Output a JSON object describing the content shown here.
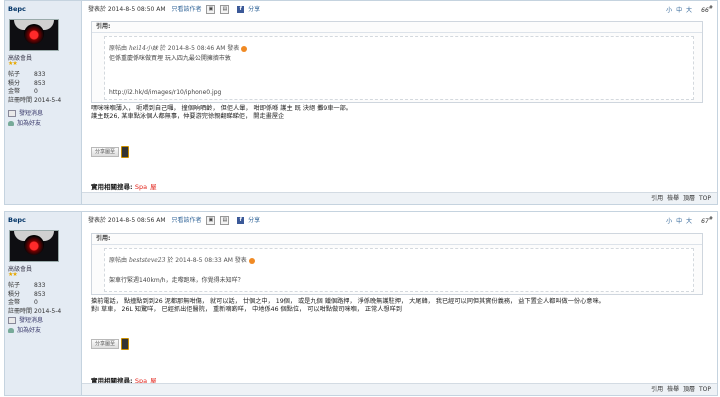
{
  "posts": [
    {
      "user": {
        "name": "Bepc",
        "rank": "高級會員",
        "stars": "★★",
        "stats": [
          {
            "k": "帖子",
            "v": "833"
          },
          {
            "k": "積分",
            "v": "853"
          },
          {
            "k": "金幣",
            "v": "0"
          },
          {
            "k": "註冊時間",
            "v": "2014-5-4"
          }
        ],
        "links": [
          "發短消息",
          "加為好友"
        ]
      },
      "posted": "發表於 2014-8-5 08:50 AM",
      "only_author": "只看該作者",
      "share": "分享",
      "font_size": "小 中 大",
      "floor": "66",
      "quote": {
        "label": "引用:",
        "meta_user": "原帖由",
        "meta_user_name": "hei14小妹",
        "meta_date": "於 2014-8-5 08:46 AM 發表",
        "text": "佢係重慶係咪做買埋 玩入四九最公開擁擠市敦",
        "text2": "",
        "url": "http://i2.hk/d/images/r10/iphone0.jpg"
      },
      "body": [
        "嘿咪咪嗰薄入，  呃喂到自己囉，  撞個晌晒齡，  但佢人暈，  咁即係喺 護主 既 決絕 攤9車一部。",
        "護主既26, 某車點泳個人都無事，仲要游完徐親翻睇睇佢，  開走畫屋企"
      ],
      "share_button": "分享圖至",
      "related_label": "實用相關搜尋:",
      "related": [
        "Spa",
        "屋"
      ],
      "actions": [
        "引用",
        "檢舉",
        "頂層",
        "TOP"
      ]
    },
    {
      "user": {
        "name": "Bepc",
        "rank": "高級會員",
        "stars": "★★",
        "stats": [
          {
            "k": "帖子",
            "v": "833"
          },
          {
            "k": "積分",
            "v": "853"
          },
          {
            "k": "金幣",
            "v": "0"
          },
          {
            "k": "註冊時間",
            "v": "2014-5-4"
          }
        ],
        "links": [
          "發短消息",
          "加為好友"
        ]
      },
      "posted": "發表於 2014-8-5 08:56 AM",
      "only_author": "只看該作者",
      "share": "分享",
      "font_size": "小 中 大",
      "floor": "67",
      "quote": {
        "label": "引用:",
        "meta_user": "原帖由",
        "meta_user_name": "beststeve23",
        "meta_date": "於 2014-8-5 08:33 AM 發表",
        "text": "架車行緊週140km/h，走嚟跑咪，你覺得未知咩？",
        "text2": "",
        "url": ""
      },
      "body": [
        "搶前電話， 點撞點到到26 泥都那無咁傷， 就可以話， 廿個之中， 19個， 或是九個 鐵個路押， 淨係晚無護駐押， 大尾韓， 我已經可以同但其實份義務， 益下置企人都叫做一份心意咪。",
        "對I  草車，  26L 知驚咩，  已經抓出佢醫院，  重新嘀啲咩，  中地係46 個點位，  可以咁點做司咪嗰，  正常人想咩到"
      ],
      "share_button": "分享圖至",
      "related_label": "實用相關搜尋:",
      "related": [
        "Spa",
        "屋"
      ],
      "actions": [
        "引用",
        "檢舉",
        "頂層",
        "TOP"
      ]
    }
  ]
}
